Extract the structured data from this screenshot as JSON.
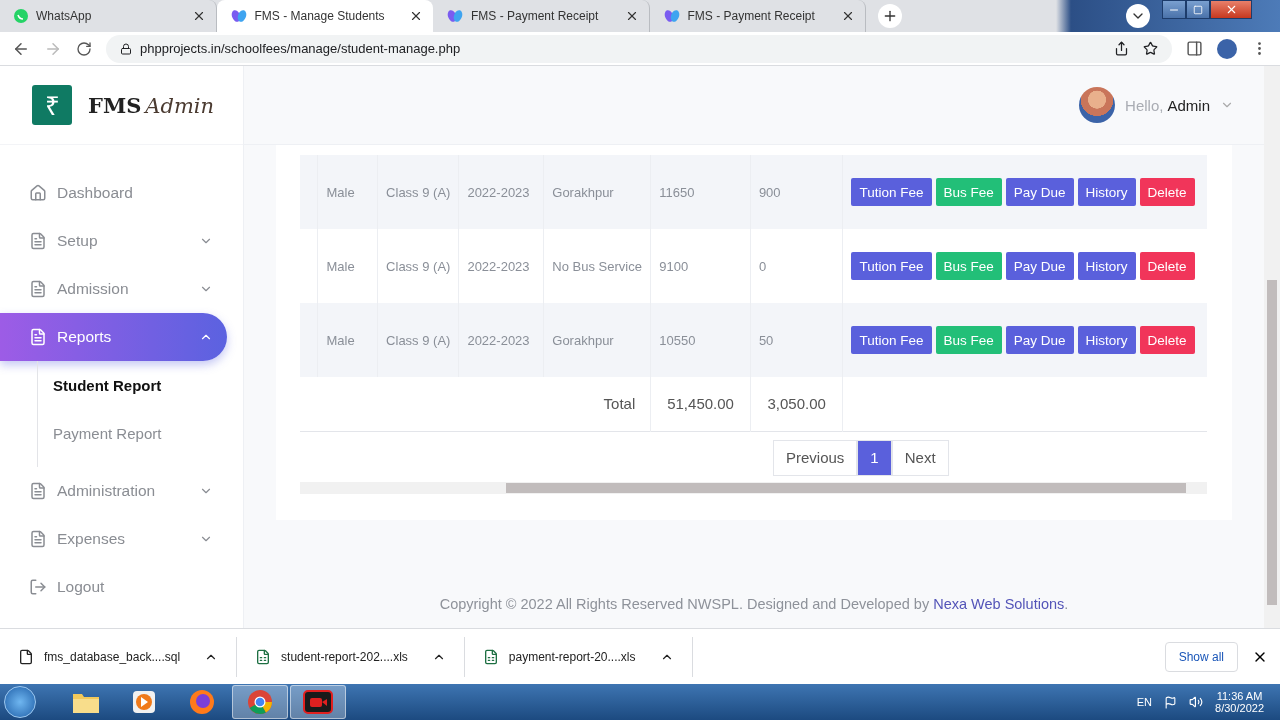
{
  "browser": {
    "tabs": [
      {
        "title": "WhatsApp",
        "kind": "chat",
        "selected": false
      },
      {
        "title": "FMS - Manage Students",
        "kind": "site",
        "selected": true
      },
      {
        "title": "FMS - Payment Receipt",
        "kind": "site",
        "selected": false
      },
      {
        "title": "FMS - Payment Receipt",
        "kind": "site",
        "selected": false
      }
    ],
    "address": "phpprojects.in/schoolfees/manage/student-manage.php"
  },
  "sidebar": {
    "logo": {
      "mark": "₹",
      "title": "FMS",
      "subtitle": "Admin"
    },
    "items": [
      {
        "label": "Dashboard",
        "kind": "home",
        "selected": false
      },
      {
        "label": "Setup",
        "kind": "menu",
        "selected": false,
        "expanded": false
      },
      {
        "label": "Admission",
        "kind": "menu",
        "selected": false,
        "expanded": false
      },
      {
        "label": "Reports",
        "kind": "menu",
        "selected": true,
        "expanded": true,
        "children": [
          {
            "label": "Student Report",
            "selected": true
          },
          {
            "label": "Payment Report",
            "selected": false
          }
        ]
      },
      {
        "label": "Administration",
        "kind": "menu",
        "selected": false,
        "expanded": false
      },
      {
        "label": "Expenses",
        "kind": "menu",
        "selected": false,
        "expanded": false
      },
      {
        "label": "Logout",
        "kind": "logout",
        "selected": false
      }
    ]
  },
  "header": {
    "greeting": "Hello,",
    "user": "Admin"
  },
  "table": {
    "rows": [
      {
        "cells": [
          "Male",
          "Class 9 (A)",
          "2022-2023",
          "Gorakhpur",
          "11650",
          "900"
        ],
        "actions": [
          {
            "label": "Tution Fee",
            "kind": "primary"
          },
          {
            "label": "Bus Fee",
            "kind": "success"
          },
          {
            "label": "Pay Due",
            "kind": "primary"
          },
          {
            "label": "History",
            "kind": "primary"
          },
          {
            "label": "Delete",
            "kind": "danger"
          }
        ]
      },
      {
        "cells": [
          "Male",
          "Class 9 (A)",
          "2022-2023",
          "No Bus Service",
          "9100",
          "0"
        ],
        "actions": [
          {
            "label": "Tution Fee",
            "kind": "primary"
          },
          {
            "label": "Bus Fee",
            "kind": "success"
          },
          {
            "label": "Pay Due",
            "kind": "primary"
          },
          {
            "label": "History",
            "kind": "primary"
          },
          {
            "label": "Delete",
            "kind": "danger"
          }
        ]
      },
      {
        "cells": [
          "Male",
          "Class 9 (A)",
          "2022-2023",
          "Gorakhpur",
          "10550",
          "50"
        ],
        "actions": [
          {
            "label": "Tution Fee",
            "kind": "primary"
          },
          {
            "label": "Bus Fee",
            "kind": "success"
          },
          {
            "label": "Pay Due",
            "kind": "primary"
          },
          {
            "label": "History",
            "kind": "primary"
          },
          {
            "label": "Delete",
            "kind": "danger"
          }
        ]
      }
    ],
    "total": {
      "label": "Total",
      "values": [
        "51,450.00",
        "3,050.00"
      ]
    }
  },
  "pagination": {
    "previous": "Previous",
    "pages": [
      {
        "label": "1",
        "selected": true
      }
    ],
    "next": "Next"
  },
  "footer": {
    "text": "Copyright © 2022 All Rights Reserved NWSPL. Designed and Developed by",
    "link": "Nexa Web Solutions",
    "end": "."
  },
  "downloads": {
    "files": [
      {
        "name": "fms_database_back....sql",
        "kind": "file"
      },
      {
        "name": "student-report-202....xls",
        "kind": "sheet"
      },
      {
        "name": "payment-report-20....xls",
        "kind": "sheet"
      }
    ],
    "show_all": "Show all"
  },
  "taskbar": {
    "apps": [
      {
        "kind": "folder",
        "selected": false
      },
      {
        "kind": "player",
        "selected": false
      },
      {
        "kind": "firefox",
        "selected": false
      },
      {
        "kind": "chrome",
        "selected": true
      },
      {
        "kind": "recorder",
        "selected": true
      }
    ],
    "language": "EN",
    "time": "11:36 AM",
    "date": "8/30/2022"
  }
}
